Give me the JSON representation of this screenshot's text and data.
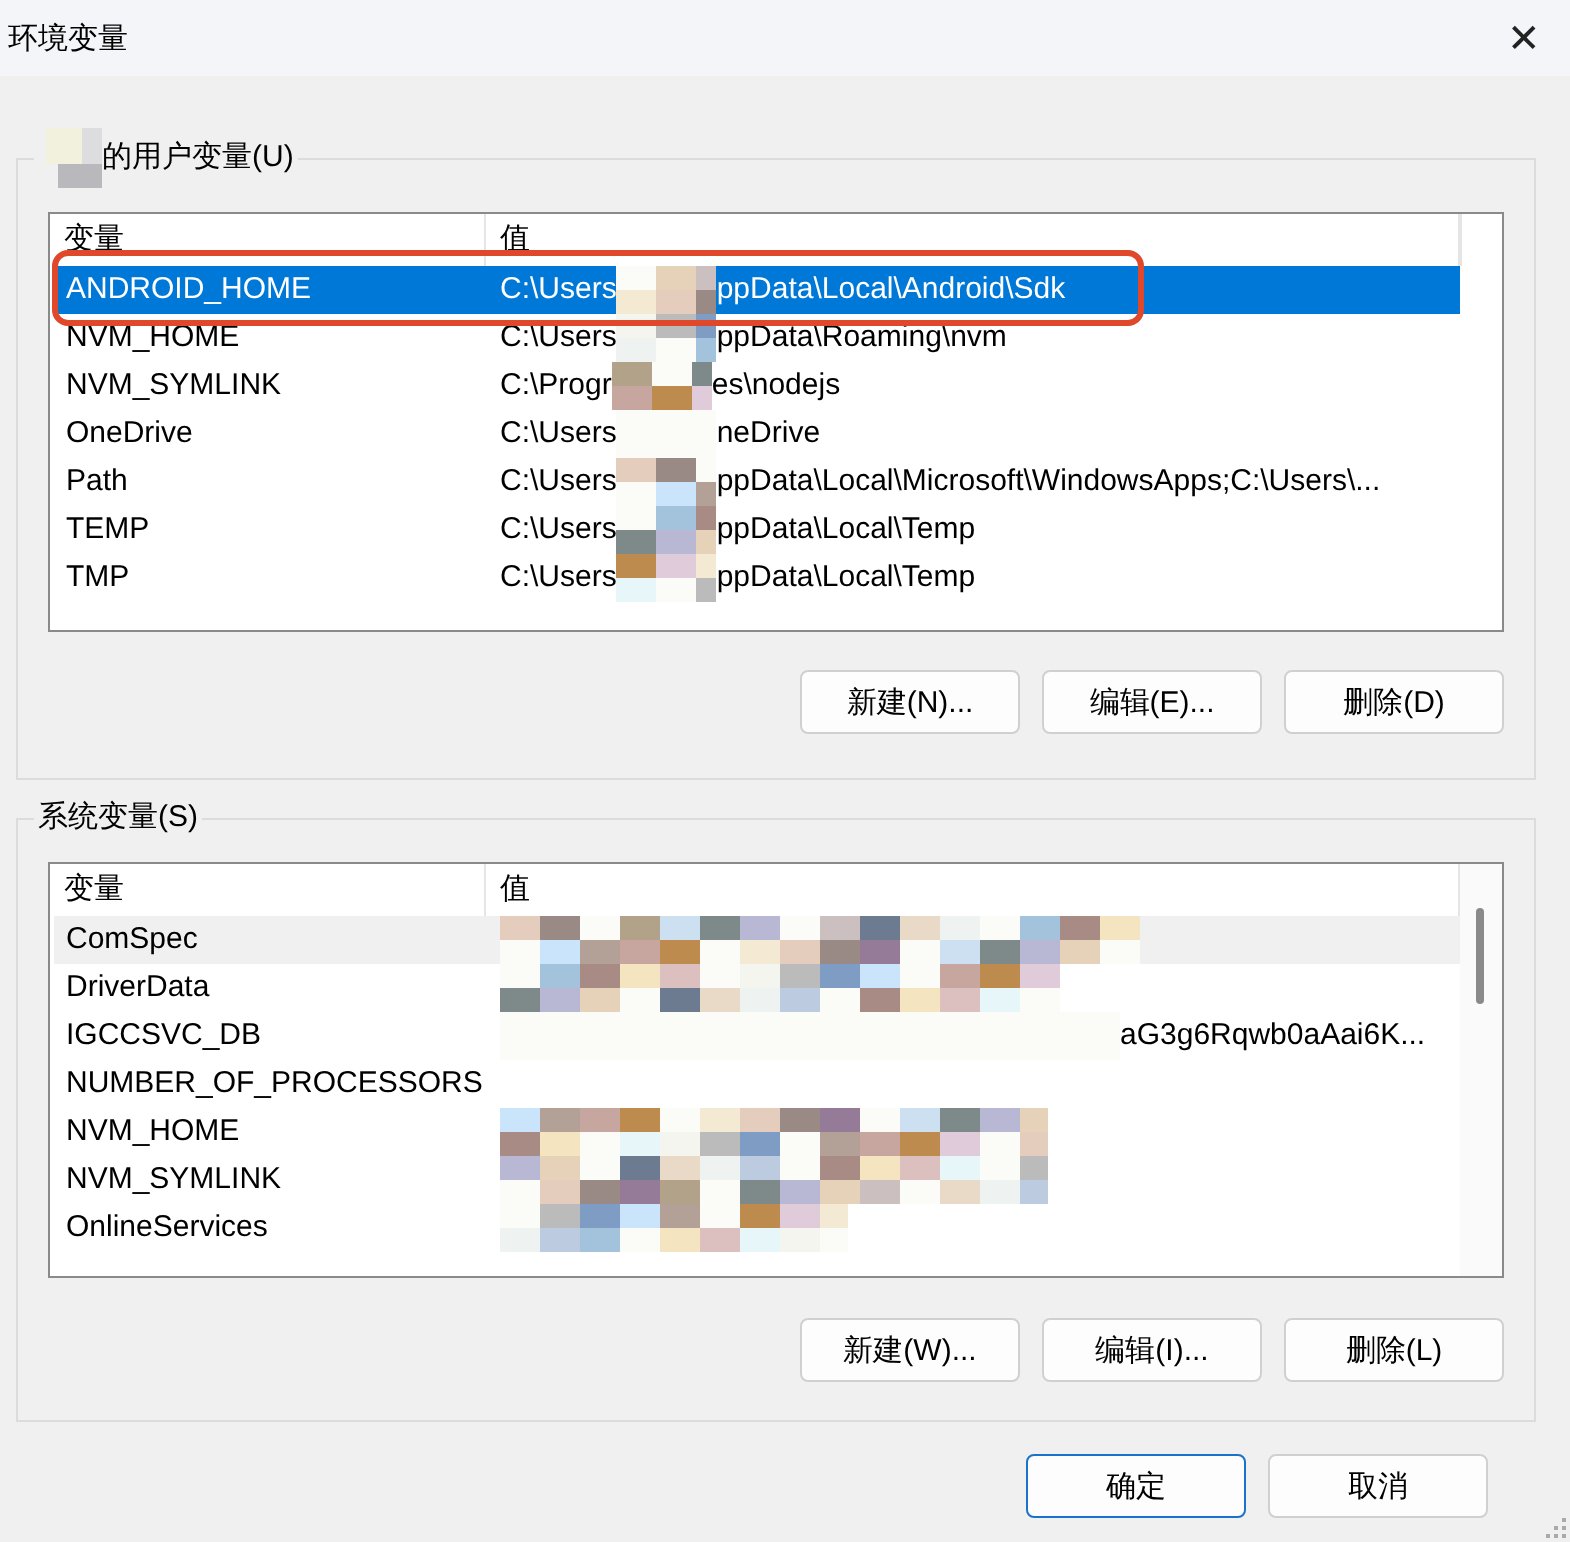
{
  "window": {
    "title": "环境变量",
    "close": "✕"
  },
  "user_variables": {
    "label": "的用户变量(U)",
    "owner_redacted": true,
    "columns": [
      "变量",
      "值"
    ],
    "rows": [
      {
        "name": "ANDROID_HOME",
        "value": {
          "before": "C:\\Users",
          "after": "ppData\\Local\\Android\\Sdk"
        },
        "redacted": true,
        "selected": true,
        "highlighted": true
      },
      {
        "name": "NVM_HOME",
        "value": {
          "before": "C:\\Users",
          "after": "ppData\\Roaming\\nvm"
        },
        "redacted": true,
        "selected": false,
        "highlighted": false
      },
      {
        "name": "NVM_SYMLINK",
        "value": {
          "before": "C:\\Progr",
          "after": "es\\nodejs"
        },
        "redacted": true,
        "selected": false,
        "highlighted": false
      },
      {
        "name": "OneDrive",
        "value": {
          "before": "C:\\Users",
          "after": "neDrive"
        },
        "redacted": true,
        "selected": false,
        "highlighted": false
      },
      {
        "name": "Path",
        "value": {
          "before": "C:\\Users",
          "after": "ppData\\Local\\Microsoft\\WindowsApps;C:\\Users\\..."
        },
        "redacted": true,
        "selected": false,
        "highlighted": false
      },
      {
        "name": "TEMP",
        "value": {
          "before": "C:\\Users",
          "after": "ppData\\Local\\Temp"
        },
        "redacted": true,
        "selected": false,
        "highlighted": false
      },
      {
        "name": "TMP",
        "value": {
          "before": "C:\\Users",
          "after": "ppData\\Local\\Temp"
        },
        "redacted": true,
        "selected": false,
        "highlighted": false
      }
    ],
    "buttons": [
      "新建(N)...",
      "编辑(E)...",
      "删除(D)"
    ]
  },
  "system_variables": {
    "label": "系统变量(S)",
    "columns": [
      "变量",
      "值"
    ],
    "rows": [
      {
        "name": "ComSpec",
        "redacted": true,
        "hovered": true
      },
      {
        "name": "DriverData",
        "redacted": true,
        "hovered": false
      },
      {
        "name": "IGCCSVC_DB",
        "value": {
          "after": "aG3g6Rqwb0aAai6K..."
        },
        "redacted": true,
        "hovered": false
      },
      {
        "name": "NUMBER_OF_PROCESSORS",
        "redacted": false,
        "hovered": false
      },
      {
        "name": "NVM_HOME",
        "redacted": true,
        "hovered": false
      },
      {
        "name": "NVM_SYMLINK",
        "redacted": true,
        "hovered": false
      },
      {
        "name": "OnlineServices",
        "redacted": true,
        "hovered": false
      }
    ],
    "buttons": [
      "新建(W)...",
      "编辑(I)...",
      "删除(L)"
    ]
  },
  "footer_buttons": [
    {
      "label": "确定",
      "default": true
    },
    {
      "label": "取消",
      "default": false
    }
  ]
}
